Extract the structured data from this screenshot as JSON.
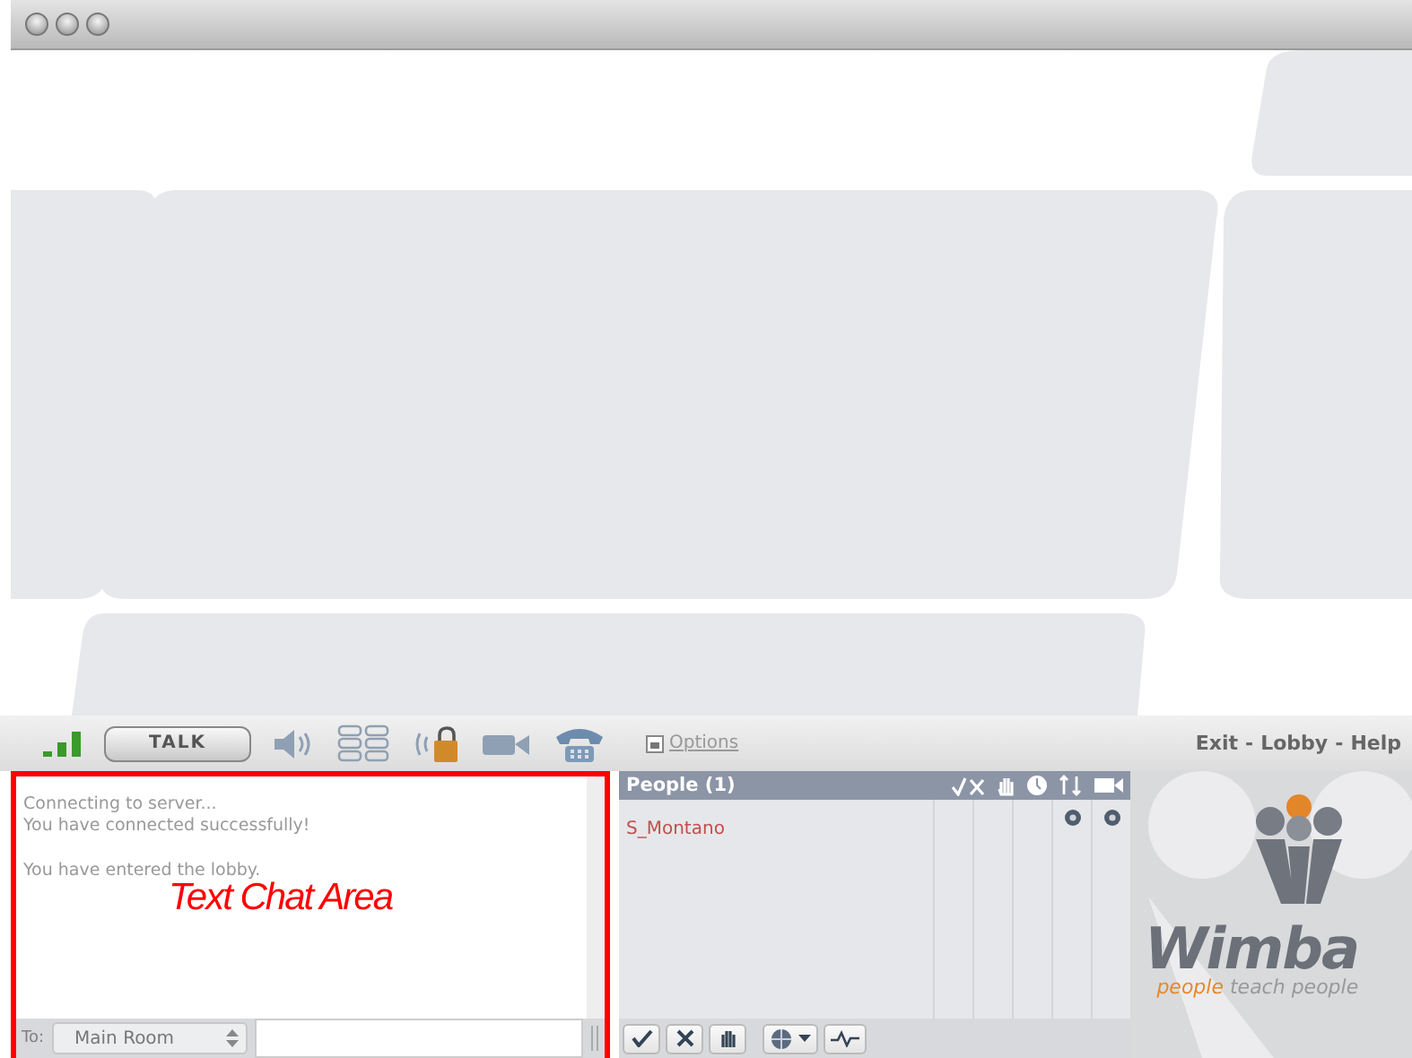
{
  "toolbar": {
    "talk_button": "TALK",
    "options_link": "Options",
    "links": [
      {
        "label": "Exit"
      },
      {
        "label": "Lobby"
      },
      {
        "label": "Help"
      }
    ],
    "separators": [
      "-",
      "-"
    ]
  },
  "chat": {
    "messages": [
      {
        "text": "Connecting to server..."
      },
      {
        "text": "You have connected successfully!"
      },
      {
        "text": "You have entered the lobby."
      }
    ],
    "annotation": "Text Chat Area",
    "to_label": "To:",
    "room_select": "Main Room"
  },
  "people": {
    "title": "People (1)",
    "rows": [
      {
        "name": "S_Montano",
        "indicators": [
          false,
          false,
          false,
          true,
          true
        ]
      }
    ]
  },
  "logo": {
    "name": "Wimba",
    "tagline_accent": "people",
    "tagline_rest": "teach people"
  }
}
